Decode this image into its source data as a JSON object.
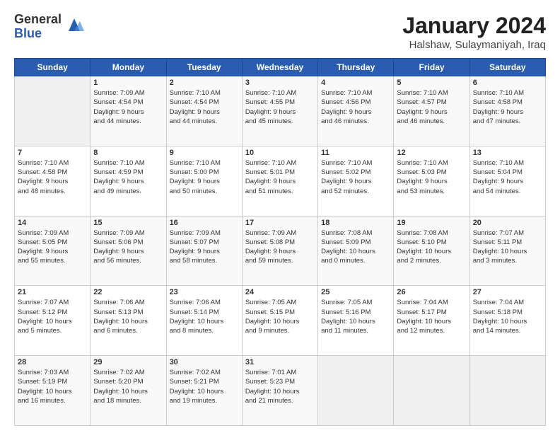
{
  "logo": {
    "general": "General",
    "blue": "Blue"
  },
  "header": {
    "month": "January 2024",
    "location": "Halshaw, Sulaymaniyah, Iraq"
  },
  "days": [
    "Sunday",
    "Monday",
    "Tuesday",
    "Wednesday",
    "Thursday",
    "Friday",
    "Saturday"
  ],
  "weeks": [
    [
      {
        "day": "",
        "info": ""
      },
      {
        "day": "1",
        "info": "Sunrise: 7:09 AM\nSunset: 4:54 PM\nDaylight: 9 hours\nand 44 minutes."
      },
      {
        "day": "2",
        "info": "Sunrise: 7:10 AM\nSunset: 4:54 PM\nDaylight: 9 hours\nand 44 minutes."
      },
      {
        "day": "3",
        "info": "Sunrise: 7:10 AM\nSunset: 4:55 PM\nDaylight: 9 hours\nand 45 minutes."
      },
      {
        "day": "4",
        "info": "Sunrise: 7:10 AM\nSunset: 4:56 PM\nDaylight: 9 hours\nand 46 minutes."
      },
      {
        "day": "5",
        "info": "Sunrise: 7:10 AM\nSunset: 4:57 PM\nDaylight: 9 hours\nand 46 minutes."
      },
      {
        "day": "6",
        "info": "Sunrise: 7:10 AM\nSunset: 4:58 PM\nDaylight: 9 hours\nand 47 minutes."
      }
    ],
    [
      {
        "day": "7",
        "info": "Sunrise: 7:10 AM\nSunset: 4:58 PM\nDaylight: 9 hours\nand 48 minutes."
      },
      {
        "day": "8",
        "info": "Sunrise: 7:10 AM\nSunset: 4:59 PM\nDaylight: 9 hours\nand 49 minutes."
      },
      {
        "day": "9",
        "info": "Sunrise: 7:10 AM\nSunset: 5:00 PM\nDaylight: 9 hours\nand 50 minutes."
      },
      {
        "day": "10",
        "info": "Sunrise: 7:10 AM\nSunset: 5:01 PM\nDaylight: 9 hours\nand 51 minutes."
      },
      {
        "day": "11",
        "info": "Sunrise: 7:10 AM\nSunset: 5:02 PM\nDaylight: 9 hours\nand 52 minutes."
      },
      {
        "day": "12",
        "info": "Sunrise: 7:10 AM\nSunset: 5:03 PM\nDaylight: 9 hours\nand 53 minutes."
      },
      {
        "day": "13",
        "info": "Sunrise: 7:10 AM\nSunset: 5:04 PM\nDaylight: 9 hours\nand 54 minutes."
      }
    ],
    [
      {
        "day": "14",
        "info": "Sunrise: 7:09 AM\nSunset: 5:05 PM\nDaylight: 9 hours\nand 55 minutes."
      },
      {
        "day": "15",
        "info": "Sunrise: 7:09 AM\nSunset: 5:06 PM\nDaylight: 9 hours\nand 56 minutes."
      },
      {
        "day": "16",
        "info": "Sunrise: 7:09 AM\nSunset: 5:07 PM\nDaylight: 9 hours\nand 58 minutes."
      },
      {
        "day": "17",
        "info": "Sunrise: 7:09 AM\nSunset: 5:08 PM\nDaylight: 9 hours\nand 59 minutes."
      },
      {
        "day": "18",
        "info": "Sunrise: 7:08 AM\nSunset: 5:09 PM\nDaylight: 10 hours\nand 0 minutes."
      },
      {
        "day": "19",
        "info": "Sunrise: 7:08 AM\nSunset: 5:10 PM\nDaylight: 10 hours\nand 2 minutes."
      },
      {
        "day": "20",
        "info": "Sunrise: 7:07 AM\nSunset: 5:11 PM\nDaylight: 10 hours\nand 3 minutes."
      }
    ],
    [
      {
        "day": "21",
        "info": "Sunrise: 7:07 AM\nSunset: 5:12 PM\nDaylight: 10 hours\nand 5 minutes."
      },
      {
        "day": "22",
        "info": "Sunrise: 7:06 AM\nSunset: 5:13 PM\nDaylight: 10 hours\nand 6 minutes."
      },
      {
        "day": "23",
        "info": "Sunrise: 7:06 AM\nSunset: 5:14 PM\nDaylight: 10 hours\nand 8 minutes."
      },
      {
        "day": "24",
        "info": "Sunrise: 7:05 AM\nSunset: 5:15 PM\nDaylight: 10 hours\nand 9 minutes."
      },
      {
        "day": "25",
        "info": "Sunrise: 7:05 AM\nSunset: 5:16 PM\nDaylight: 10 hours\nand 11 minutes."
      },
      {
        "day": "26",
        "info": "Sunrise: 7:04 AM\nSunset: 5:17 PM\nDaylight: 10 hours\nand 12 minutes."
      },
      {
        "day": "27",
        "info": "Sunrise: 7:04 AM\nSunset: 5:18 PM\nDaylight: 10 hours\nand 14 minutes."
      }
    ],
    [
      {
        "day": "28",
        "info": "Sunrise: 7:03 AM\nSunset: 5:19 PM\nDaylight: 10 hours\nand 16 minutes."
      },
      {
        "day": "29",
        "info": "Sunrise: 7:02 AM\nSunset: 5:20 PM\nDaylight: 10 hours\nand 18 minutes."
      },
      {
        "day": "30",
        "info": "Sunrise: 7:02 AM\nSunset: 5:21 PM\nDaylight: 10 hours\nand 19 minutes."
      },
      {
        "day": "31",
        "info": "Sunrise: 7:01 AM\nSunset: 5:23 PM\nDaylight: 10 hours\nand 21 minutes."
      },
      {
        "day": "",
        "info": ""
      },
      {
        "day": "",
        "info": ""
      },
      {
        "day": "",
        "info": ""
      }
    ]
  ]
}
